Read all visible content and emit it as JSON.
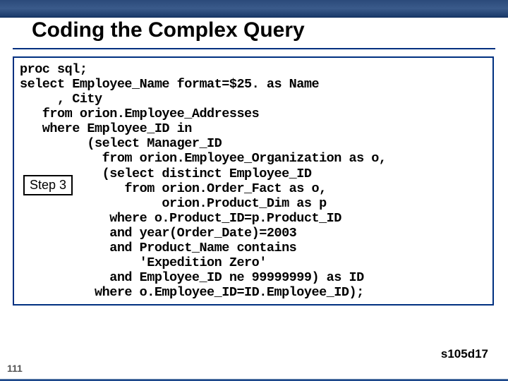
{
  "title": "Coding the Complex Query",
  "stepLabel": "Step 3",
  "pageNumber": "111",
  "refId": "s105d17",
  "code": "proc sql;\nselect Employee_Name format=$25. as Name\n     , City\n   from orion.Employee_Addresses\n   where Employee_ID in\n         (select Manager_ID\n           from orion.Employee_Organization as o,\n           (select distinct Employee_ID\n              from orion.Order_Fact as o,\n                   orion.Product_Dim as p\n            where o.Product_ID=p.Product_ID\n            and year(Order_Date)=2003\n            and Product_Name contains\n                'Expedition Zero'\n            and Employee_ID ne 99999999) as ID\n          where o.Employee_ID=ID.Employee_ID);"
}
